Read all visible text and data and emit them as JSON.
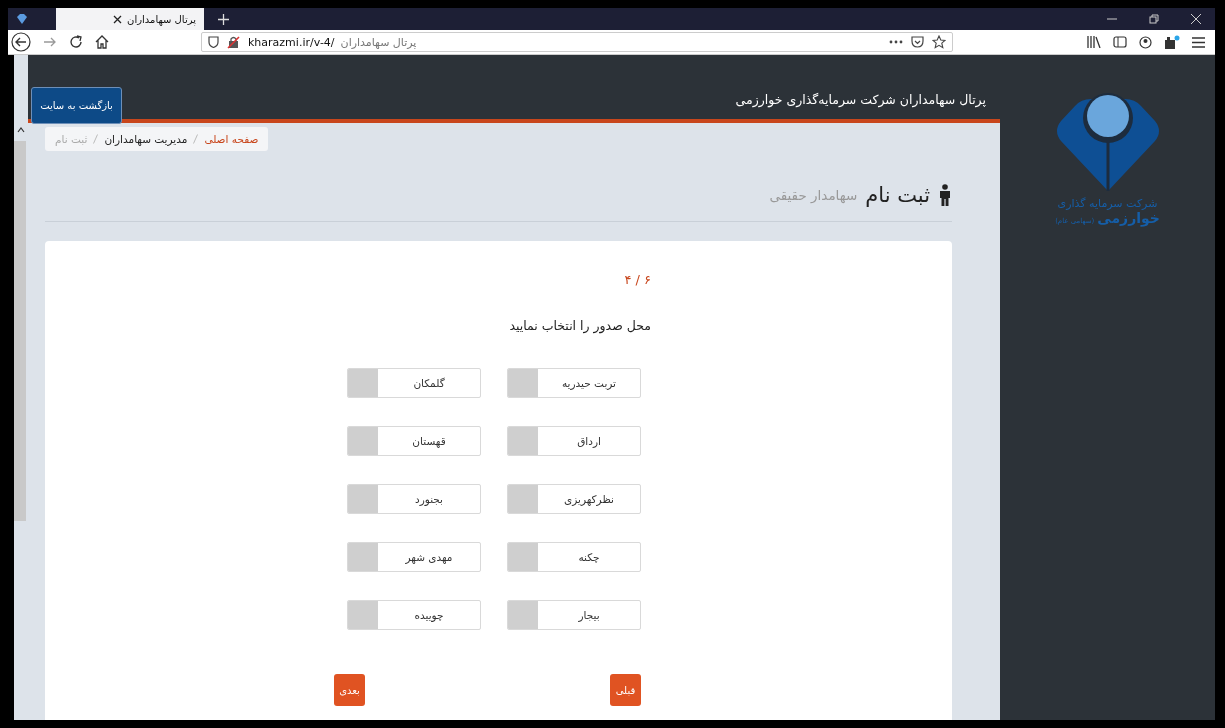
{
  "browser": {
    "tab": {
      "title": "پرتال سهامداران"
    },
    "address": {
      "url": "kharazmi.ir/v-4/",
      "page_title": "پرتال سهامداران"
    }
  },
  "header": {
    "title": "پرتال سهامداران شرکت سرمایه‌گذاری خوارزمی"
  },
  "back_button": "بازگشت به سایت",
  "breadcrumb": [
    {
      "label": "صفحه اصلی",
      "kind": "link"
    },
    {
      "label": "مدیریت سهامداران",
      "kind": "item"
    },
    {
      "label": "ثبت نام",
      "kind": "current"
    }
  ],
  "heading": {
    "title": "ثبت نام",
    "subtitle": "سهامدار حقیقی"
  },
  "step": "۴ / ۶",
  "prompt": "محل صدور را انتخاب نمایید",
  "options": [
    {
      "label": "تربت حیدریه",
      "selected": false
    },
    {
      "label": "گلمکان",
      "selected": false
    },
    {
      "label": "ارداق",
      "selected": false
    },
    {
      "label": "قهستان",
      "selected": false
    },
    {
      "label": "نظرکهریزی",
      "selected": false
    },
    {
      "label": "بجنورد",
      "selected": false
    },
    {
      "label": "چکنه",
      "selected": false
    },
    {
      "label": "مهدی شهر",
      "selected": false
    },
    {
      "label": "بیجار",
      "selected": false
    },
    {
      "label": "چوییده",
      "selected": false
    }
  ],
  "buttons": {
    "previous": "قبلی",
    "next": "بعدی"
  },
  "logo": {
    "line_1": "شرکت سرمایه گذاری",
    "line_2": "خوارزمی",
    "line_3": "(سهامی عام)"
  }
}
